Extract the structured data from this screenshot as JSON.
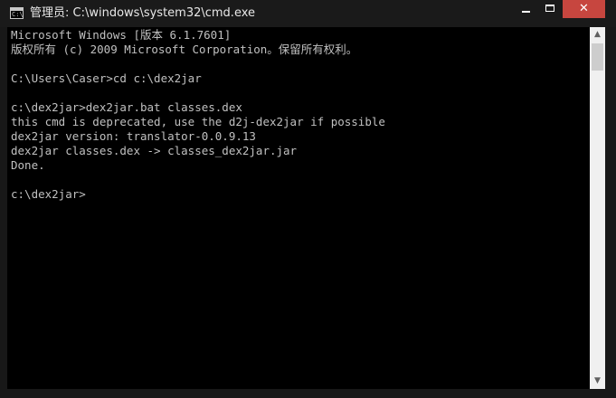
{
  "window": {
    "title": "管理员: C:\\windows\\system32\\cmd.exe",
    "app_icon": "cmd-prompt-icon",
    "app_icon_glyph": "C:\\",
    "controls": {
      "minimize_icon": "minimize-icon",
      "maximize_icon": "maximize-icon",
      "close_icon": "close-icon",
      "close_glyph": "✕"
    }
  },
  "console": {
    "lines": [
      "Microsoft Windows [版本 6.1.7601]",
      "版权所有 (c) 2009 Microsoft Corporation。保留所有权利。",
      "",
      "C:\\Users\\Caser>cd c:\\dex2jar",
      "",
      "c:\\dex2jar>dex2jar.bat classes.dex",
      "this cmd is deprecated, use the d2j-dex2jar if possible",
      "dex2jar version: translator-0.0.9.13",
      "dex2jar classes.dex -> classes_dex2jar.jar",
      "Done.",
      "",
      "c:\\dex2jar>"
    ]
  },
  "scrollbar": {
    "up_glyph": "▲",
    "down_glyph": "▼",
    "up_icon": "scroll-up-arrow-icon",
    "down_icon": "scroll-down-arrow-icon"
  },
  "colors": {
    "console_background": "#000000",
    "console_text": "#c0c0c0",
    "titlebar_background": "#1a1a1a",
    "close_button": "#c7463f"
  }
}
